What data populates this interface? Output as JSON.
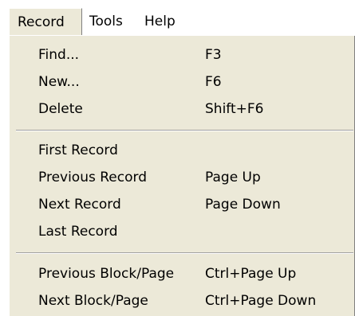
{
  "menubar": {
    "items": [
      "Record",
      "Tools",
      "Help"
    ]
  },
  "menu": {
    "groups": [
      [
        {
          "label": "Find...",
          "shortcut": "F3"
        },
        {
          "label": "New...",
          "shortcut": "F6"
        },
        {
          "label": "Delete",
          "shortcut": "Shift+F6"
        }
      ],
      [
        {
          "label": "First Record",
          "shortcut": ""
        },
        {
          "label": "Previous Record",
          "shortcut": "Page Up"
        },
        {
          "label": "Next Record",
          "shortcut": "Page Down"
        },
        {
          "label": "Last Record",
          "shortcut": ""
        }
      ],
      [
        {
          "label": "Previous Block/Page",
          "shortcut": "Ctrl+Page Up"
        },
        {
          "label": "Next Block/Page",
          "shortcut": "Ctrl+Page Down"
        }
      ]
    ]
  },
  "colors": {
    "menu_background": "#ece9d8",
    "menubar_background": "#ffffff",
    "text": "#000000"
  }
}
